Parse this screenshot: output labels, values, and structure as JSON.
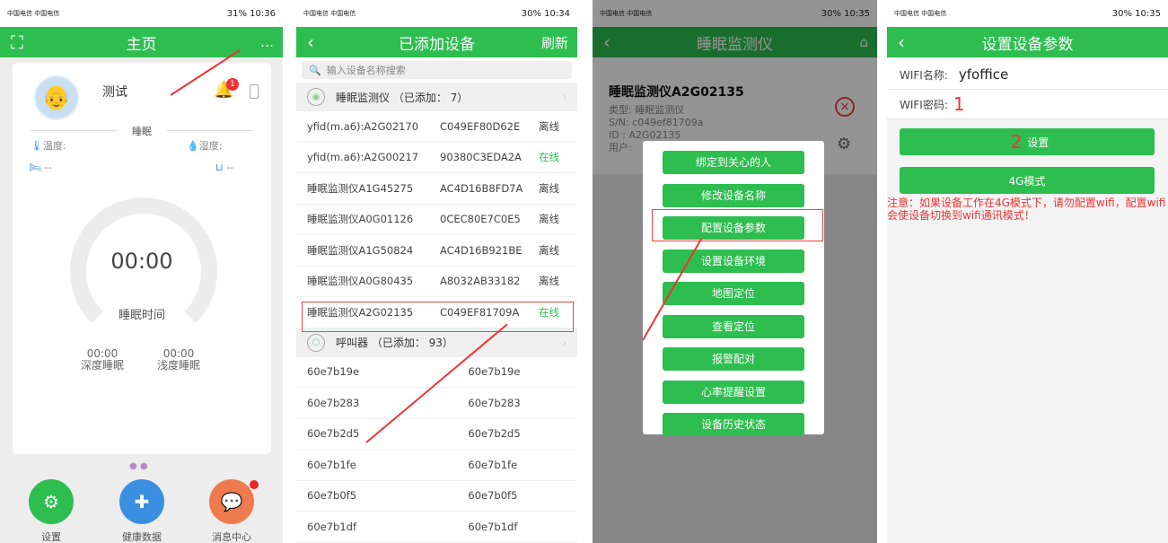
{
  "phone1": {
    "status": {
      "carrier": "中国电信 中国电信",
      "right": "31% 10:36"
    },
    "title": "主页",
    "menu_icon": "…",
    "user_name": "测试",
    "notif_count": "1",
    "section_label": "睡眠",
    "temp_label": "温度:",
    "humid_label": "湿度:",
    "bed_left": "--",
    "bed_right": "--",
    "time": "00:00",
    "time_label": "睡眠时间",
    "deep_time": "00:00",
    "deep_label": "深度睡眠",
    "light_time": "00:00",
    "light_label": "浅度睡眠",
    "nav": [
      {
        "label": "设置",
        "icon": "settings-icon",
        "color": "#2dbe4f"
      },
      {
        "label": "健康数据",
        "icon": "medical-kit-icon",
        "color": "#3b8fe0"
      },
      {
        "label": "消息中心",
        "icon": "chat-icon",
        "color": "#ef7a4d"
      }
    ]
  },
  "phone2": {
    "status": {
      "carrier": "中国电信 中国电信",
      "right": "30% 10:34"
    },
    "title": "已添加设备",
    "right_action": "刷新",
    "search_placeholder": "输入设备名称搜索",
    "group1": "睡眠监测仪 （已添加： 7）",
    "rows1": [
      {
        "name": "yfid(m.a6):A2G02170",
        "id": "C049EF80D62E",
        "status": "离线"
      },
      {
        "name": "yfid(m.a6):A2G00217",
        "id": "90380C3EDA2A",
        "status": "在线"
      },
      {
        "name": "睡眠监测仪A1G45275",
        "id": "AC4D16B8FD7A",
        "status": "离线"
      },
      {
        "name": "睡眠监测仪A0G01126",
        "id": "0CEC80E7C0E5",
        "status": "离线"
      },
      {
        "name": "睡眠监测仪A1G50824",
        "id": "AC4D16B921BE",
        "status": "离线"
      },
      {
        "name": "睡眠监测仪A0G80435",
        "id": "A8032AB33182",
        "status": "离线"
      },
      {
        "name": "睡眠监测仪A2G02135",
        "id": "C049EF81709A",
        "status": "在线"
      }
    ],
    "group2": "呼叫器 （已添加： 93）",
    "rows2": [
      {
        "name": "60e7b19e",
        "id": "60e7b19e"
      },
      {
        "name": "60e7b283",
        "id": "60e7b283"
      },
      {
        "name": "60e7b2d5",
        "id": "60e7b2d5"
      },
      {
        "name": "60e7b1fe",
        "id": "60e7b1fe"
      },
      {
        "name": "60e7b0f5",
        "id": "60e7b0f5"
      },
      {
        "name": "60e7b1df",
        "id": "60e7b1df"
      }
    ]
  },
  "phone3": {
    "status": {
      "carrier": "中国电信 中国电信",
      "right": "30% 10:35"
    },
    "title": "睡眠监测仪",
    "device_title": "睡眠监测仪A2G02135",
    "type_line": "类型:   睡眠监测仪",
    "sn_line": "S/N:    c049ef81709a",
    "id_line": "ID :    A2G02135",
    "user_line": "用户:",
    "menu": [
      "绑定到关心的人",
      "修改设备名称",
      "配置设备参数",
      "设置设备环境",
      "地图定位",
      "查看定位",
      "报警配对",
      "心率提醒设置",
      "设备历史状态"
    ]
  },
  "phone4": {
    "status": {
      "carrier": "中国电信 中国电信",
      "right": "30% 10:35"
    },
    "title": "设置设备参数",
    "wifi_name_label": "WIFI名称:",
    "wifi_name_value": "yfoffice",
    "wifi_pwd_label": "WIFI密码:",
    "marker1": "1",
    "marker2": "2",
    "set_label": "设置",
    "mode_label": "4G模式",
    "note": "注意：如果设备工作在4G模式下，请勿配置wifi，配置wifi会使设备切换到wifi通讯模式！"
  },
  "colors": {
    "accent": "#2dbe4f",
    "alert": "#e33333"
  }
}
